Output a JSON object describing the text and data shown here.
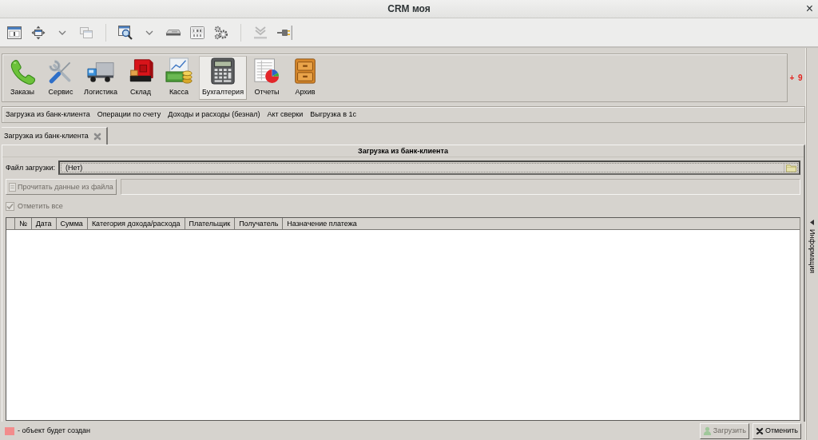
{
  "window": {
    "title": "CRM моя",
    "close": "×"
  },
  "modules": [
    {
      "label": "Заказы",
      "selected": false
    },
    {
      "label": "Сервис",
      "selected": false
    },
    {
      "label": "Логистика",
      "selected": false
    },
    {
      "label": "Склад",
      "selected": false
    },
    {
      "label": "Касса",
      "selected": false
    },
    {
      "label": "Бухгалтерия",
      "selected": true
    },
    {
      "label": "Отчеты",
      "selected": false
    },
    {
      "label": "Архив",
      "selected": false
    }
  ],
  "notification_count": "+ 9",
  "menu": [
    "Загрузка из банк-клиента",
    "Операции по счету",
    "Доходы и расходы (безнал)",
    "Акт сверки",
    "Выгрузка в 1с"
  ],
  "tabs": [
    {
      "label": "Загрузка из банк-клиента",
      "selected": true
    }
  ],
  "panel": {
    "title": "Загрузка из банк-клиента",
    "file_field": {
      "label": "Файл загрузки:",
      "value": "(Нет)"
    },
    "read_button": {
      "label": "Прочитать данные из файла",
      "disabled": true
    },
    "select_all": {
      "label": "Отметить все",
      "checked": true,
      "disabled": true
    },
    "table": {
      "columns": [
        "№",
        "Дата",
        "Сумма",
        "Категория дохода/расхода",
        "Плательщик",
        "Получатель",
        "Назначение платежа"
      ]
    }
  },
  "side_panel": {
    "label": "Информация"
  },
  "legend": [
    {
      "color": "#f28c8c",
      "text": "- объект будет создан"
    }
  ],
  "buttons": [
    {
      "label": "Загрузить",
      "kind": "load",
      "disabled": true
    },
    {
      "label": "Отменить",
      "kind": "cancel",
      "disabled": false
    }
  ]
}
